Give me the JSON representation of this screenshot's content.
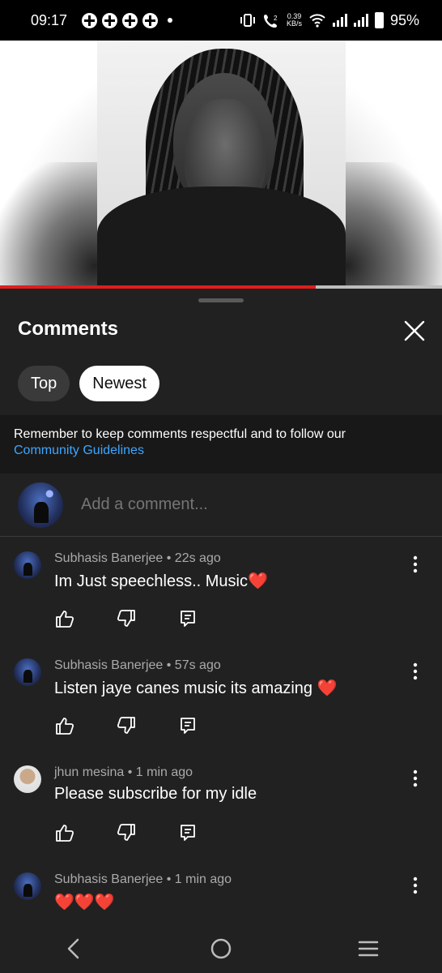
{
  "status_bar": {
    "time": "09:17",
    "net_speed_value": "0.39",
    "net_speed_unit": "KB/s",
    "battery": "95%"
  },
  "video": {
    "progress": 0.715,
    "progress_color": "#e01d1d"
  },
  "comments_panel": {
    "title": "Comments",
    "filters": [
      "Top",
      "Newest"
    ],
    "selected_filter": "Newest",
    "notice_text": "Remember to keep comments respectful and to follow our",
    "notice_link": "Community Guidelines",
    "add_comment_placeholder": "Add a comment...",
    "accent_link_color": "#3ea6ff"
  },
  "comments": [
    {
      "author": "Subhasis Banerjee",
      "time": "22s ago",
      "meta": "Subhasis Banerjee • 22s ago",
      "text": "Im Just speechless.. Music❤️",
      "avatar": "night-tree-avatar"
    },
    {
      "author": "Subhasis Banerjee",
      "time": "57s ago",
      "meta": "Subhasis Banerjee • 57s ago",
      "text": "Listen jaye canes music its amazing ❤️",
      "avatar": "night-tree-avatar"
    },
    {
      "author": "jhun mesina",
      "time": "1 min ago",
      "meta": "jhun mesina • 1 min ago",
      "text": "Please subscribe for my idle",
      "avatar": "person-avatar"
    },
    {
      "author": "Subhasis Banerjee",
      "time": "1 min ago",
      "meta": "Subhasis Banerjee • 1 min ago",
      "text": "❤️❤️❤️",
      "avatar": "night-tree-avatar"
    }
  ],
  "nav": {
    "icons": [
      "back-icon",
      "home-icon",
      "recents-icon"
    ]
  }
}
